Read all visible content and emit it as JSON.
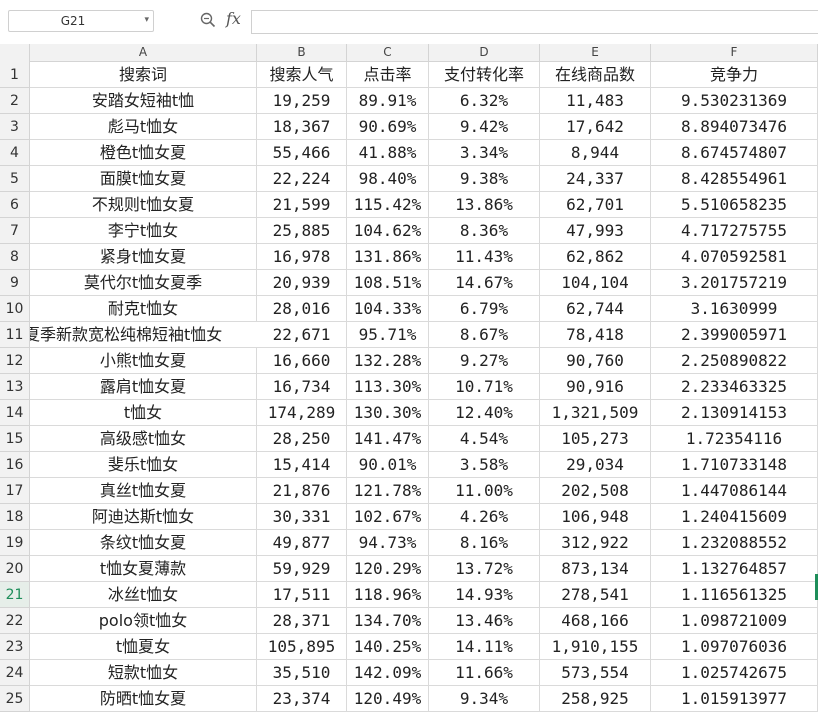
{
  "formula_bar": {
    "name_box": "G21",
    "fx_label": "fx",
    "formula_value": ""
  },
  "columns": [
    "A",
    "B",
    "C",
    "D",
    "E",
    "F"
  ],
  "active_row": "21",
  "header_row": {
    "row_number": "1",
    "cells": [
      "搜索词",
      "搜索人气",
      "点击率",
      "支付转化率",
      "在线商品数",
      "竞争力"
    ]
  },
  "rows": [
    {
      "n": "2",
      "cells": [
        "安踏女短袖t恤",
        "19,259",
        "89.91%",
        "6.32%",
        "11,483",
        "9.530231369"
      ]
    },
    {
      "n": "3",
      "cells": [
        "彪马t恤女",
        "18,367",
        "90.69%",
        "9.42%",
        "17,642",
        "8.894073476"
      ]
    },
    {
      "n": "4",
      "cells": [
        "橙色t恤女夏",
        "55,466",
        "41.88%",
        "3.34%",
        "8,944",
        "8.674574807"
      ]
    },
    {
      "n": "5",
      "cells": [
        "面膜t恤女夏",
        "22,224",
        "98.40%",
        "9.38%",
        "24,337",
        "8.428554961"
      ]
    },
    {
      "n": "6",
      "cells": [
        "不规则t恤女夏",
        "21,599",
        "115.42%",
        "13.86%",
        "62,701",
        "5.510658235"
      ]
    },
    {
      "n": "7",
      "cells": [
        "李宁t恤女",
        "25,885",
        "104.62%",
        "8.36%",
        "47,993",
        "4.717275755"
      ]
    },
    {
      "n": "8",
      "cells": [
        "紧身t恤女夏",
        "16,978",
        "131.86%",
        "11.43%",
        "62,862",
        "4.070592581"
      ]
    },
    {
      "n": "9",
      "cells": [
        "莫代尔t恤女夏季",
        "20,939",
        "108.51%",
        "14.67%",
        "104,104",
        "3.201757219"
      ]
    },
    {
      "n": "10",
      "cells": [
        "耐克t恤女",
        "28,016",
        "104.33%",
        "6.79%",
        "62,744",
        "3.1630999"
      ]
    },
    {
      "n": "11",
      "cells": [
        "夏季新款宽松纯棉短袖t恤女",
        "22,671",
        "95.71%",
        "8.67%",
        "78,418",
        "2.399005971"
      ]
    },
    {
      "n": "12",
      "cells": [
        "小熊t恤女夏",
        "16,660",
        "132.28%",
        "9.27%",
        "90,760",
        "2.250890822"
      ]
    },
    {
      "n": "13",
      "cells": [
        "露肩t恤女夏",
        "16,734",
        "113.30%",
        "10.71%",
        "90,916",
        "2.233463325"
      ]
    },
    {
      "n": "14",
      "cells": [
        "t恤女",
        "174,289",
        "130.30%",
        "12.40%",
        "1,321,509",
        "2.130914153"
      ]
    },
    {
      "n": "15",
      "cells": [
        "高级感t恤女",
        "28,250",
        "141.47%",
        "4.54%",
        "105,273",
        "1.72354116"
      ]
    },
    {
      "n": "16",
      "cells": [
        "斐乐t恤女",
        "15,414",
        "90.01%",
        "3.58%",
        "29,034",
        "1.710733148"
      ]
    },
    {
      "n": "17",
      "cells": [
        "真丝t恤女夏",
        "21,876",
        "121.78%",
        "11.00%",
        "202,508",
        "1.447086144"
      ]
    },
    {
      "n": "18",
      "cells": [
        "阿迪达斯t恤女",
        "30,331",
        "102.67%",
        "4.26%",
        "106,948",
        "1.240415609"
      ]
    },
    {
      "n": "19",
      "cells": [
        "条纹t恤女夏",
        "49,877",
        "94.73%",
        "8.16%",
        "312,922",
        "1.232088552"
      ]
    },
    {
      "n": "20",
      "cells": [
        "t恤女夏薄款",
        "59,929",
        "120.29%",
        "13.72%",
        "873,134",
        "1.132764857"
      ]
    },
    {
      "n": "21",
      "cells": [
        "冰丝t恤女",
        "17,511",
        "118.96%",
        "14.93%",
        "278,541",
        "1.116561325"
      ]
    },
    {
      "n": "22",
      "cells": [
        "polo领t恤女",
        "28,371",
        "134.70%",
        "13.46%",
        "468,166",
        "1.098721009"
      ]
    },
    {
      "n": "23",
      "cells": [
        "t恤夏女",
        "105,895",
        "140.25%",
        "14.11%",
        "1,910,155",
        "1.097076036"
      ]
    },
    {
      "n": "24",
      "cells": [
        "短款t恤女",
        "35,510",
        "142.09%",
        "11.66%",
        "573,554",
        "1.025742675"
      ]
    },
    {
      "n": "25",
      "cells": [
        "防晒t恤女夏",
        "23,374",
        "120.49%",
        "9.34%",
        "258,925",
        "1.015913977"
      ]
    }
  ]
}
